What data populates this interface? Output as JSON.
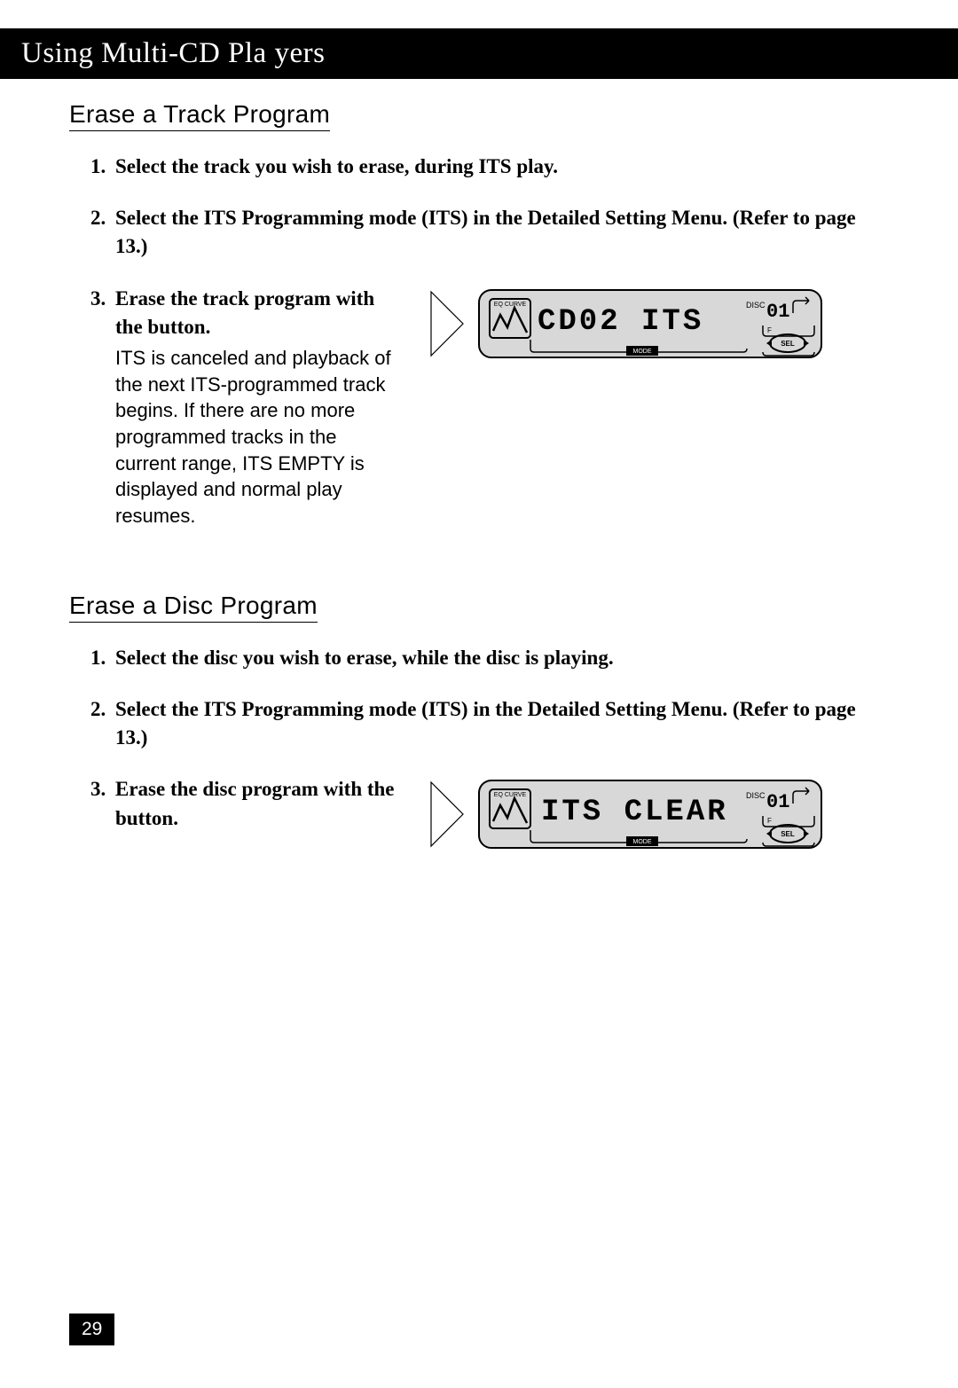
{
  "title": "Using Multi-CD Pla yers",
  "sections": [
    {
      "heading": "Erase a Track Program",
      "steps": [
        {
          "num": "1.",
          "bold": "Select the track you wish to erase, during ITS play.",
          "body": "",
          "display": null
        },
        {
          "num": "2.",
          "bold": "Select the ITS Programming mode (ITS) in the Detailed Setting Menu. (Refer to page 13.)",
          "body": "",
          "display": null
        },
        {
          "num": "3.",
          "bold": "Erase the track program with the    button.",
          "body": "ITS is canceled and playback of the next ITS-programmed track begins. If there are no more programmed tracks in the current range,  ITS EMPTY  is displayed and normal play resumes.",
          "display": {
            "text": "CD02   ITS",
            "disc": "01"
          }
        }
      ]
    },
    {
      "heading": "Erase a Disc Program",
      "steps": [
        {
          "num": "1.",
          "bold": "Select the disc you wish to erase, while the disc is playing.",
          "body": "",
          "display": null
        },
        {
          "num": "2.",
          "bold": "Select the ITS Programming mode (ITS) in the Detailed Setting Menu. (Refer to page 13.)",
          "body": "",
          "display": null
        },
        {
          "num": "3.",
          "bold": "Erase the disc program with the    button.",
          "body": "",
          "display": {
            "text": "ITS CLEAR",
            "disc": "01"
          }
        }
      ]
    }
  ],
  "page_number": "29",
  "lcd_labels": {
    "eq": "EQ CURVE",
    "mode": "MODE",
    "disc": "DISC",
    "sel": "SEL",
    "f": "F"
  }
}
